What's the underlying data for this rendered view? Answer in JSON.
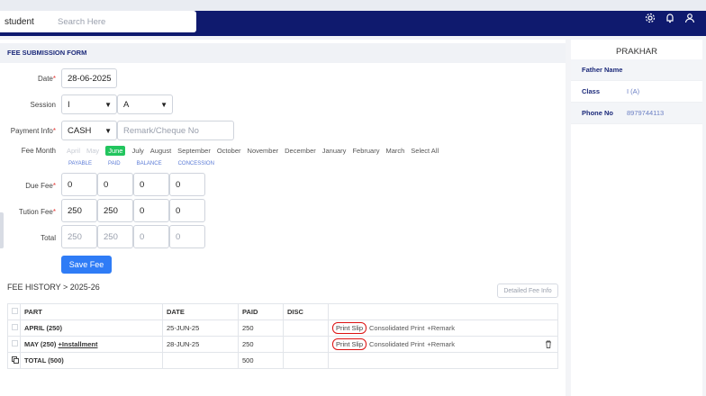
{
  "search": {
    "select": "student",
    "placeholder": "Search Here"
  },
  "form": {
    "title": "FEE SUBMISSION FORM",
    "date_label": "Date",
    "date": "28-06-2025",
    "session_label": "Session",
    "session": "I",
    "section": "A",
    "payment_label": "Payment Info",
    "payment_mode": "CASH",
    "remark_placeholder": "Remark/Cheque No",
    "fee_month_label": "Fee Month",
    "months": [
      "April",
      "May",
      "June",
      "July",
      "August",
      "September",
      "October",
      "November",
      "December",
      "January",
      "February",
      "March",
      "Select All"
    ],
    "sub_labels": [
      "PAYABLE",
      "PAID",
      "BALANCE",
      "CONCESSION"
    ],
    "due_label": "Due Fee",
    "due": [
      "0",
      "0",
      "0",
      "0"
    ],
    "tution_label": "Tution Fee",
    "tution": [
      "250",
      "250",
      "0",
      "0"
    ],
    "total_label": "Total",
    "total": [
      "250",
      "250",
      "0",
      "0"
    ],
    "save": "Save Fee"
  },
  "history": {
    "title": "FEE HISTORY > 2025-26",
    "detailed": "Detailed Fee Info",
    "headers": [
      "PART",
      "DATE",
      "PAID",
      "DISC"
    ],
    "rows": [
      {
        "part": "APRIL (250)",
        "date": "25-JUN-25",
        "paid": "250",
        "disc": ""
      },
      {
        "part": "MAY (250) ",
        "link": "+Installment",
        "date": "28-JUN-25",
        "paid": "250",
        "disc": ""
      }
    ],
    "total": {
      "label": "TOTAL (500)",
      "paid": "500"
    },
    "actions": {
      "print": "Print Slip",
      "consolidated": "Consolidated Print",
      "remark": "+Remark"
    }
  },
  "student": {
    "name": "PRAKHAR",
    "fields": [
      {
        "k": "Father Name",
        "v": ""
      },
      {
        "k": "Class",
        "v": "I (A)"
      },
      {
        "k": "Phone No",
        "v": "8979744113"
      }
    ]
  },
  "colors": {
    "nav": "#0f1a6e",
    "accent": "#2f7cf6",
    "active_month": "#22c55e",
    "highlight": "#dd1111"
  },
  "icons": [
    "settings-icon",
    "bell-icon",
    "user-icon",
    "trash-icon",
    "checkbox-icon"
  ]
}
